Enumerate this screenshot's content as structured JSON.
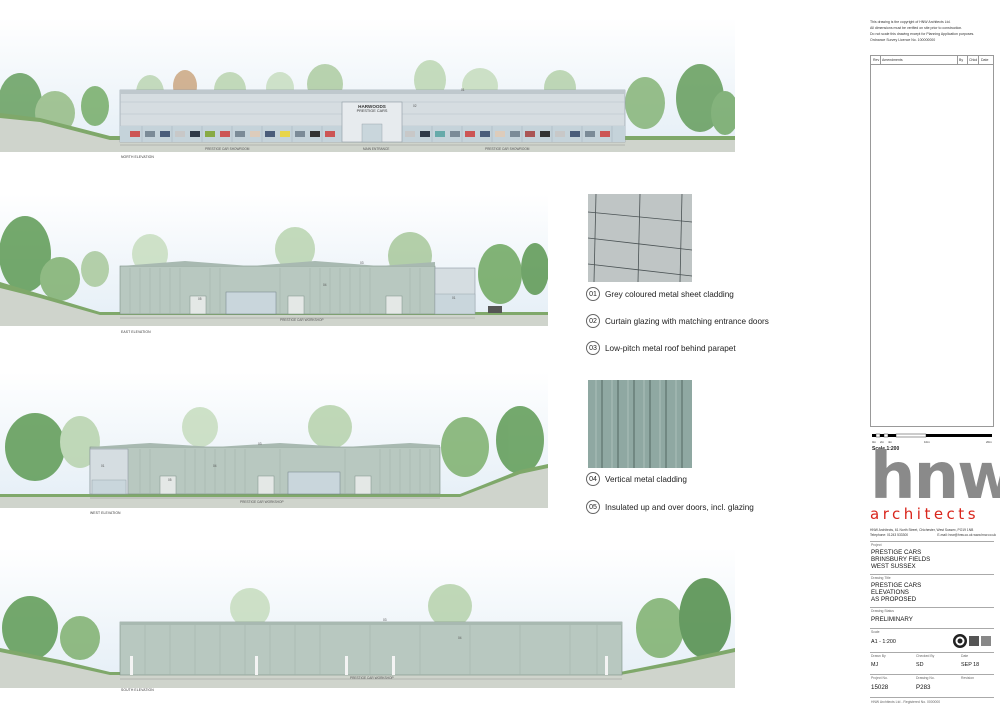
{
  "elevations": {
    "north": {
      "label": "NORTH ELEVATION",
      "sign_title": "HARWOODS",
      "sign_subtitle": "PRESTIGE CARS",
      "tag_01": "01",
      "tag_02": "02",
      "dim_left": "PRESTIGE CAR SHOWROOM",
      "dim_mid": "MAIN ENTRANCE",
      "dim_right": "PRESTIGE CAR SHOWROOM"
    },
    "east": {
      "label": "EAST ELEVATION",
      "dim": "PRESTIGE CAR WORKSHOP",
      "tag_03": "03",
      "tag_04": "04",
      "tag_05": "05",
      "tag_01": "01"
    },
    "west": {
      "label": "WEST ELEVATION",
      "dim": "PRESTIGE CAR WORKSHOP",
      "tag_03": "03",
      "tag_04": "04",
      "tag_05": "05",
      "tag_01": "01"
    },
    "south": {
      "label": "SOUTH ELEVATION",
      "dim": "PRESTIGE CAR WORKSHOP",
      "tag_03": "03",
      "tag_04": "04"
    }
  },
  "materials_key": [
    {
      "num": "01",
      "text": "Grey coloured metal sheet cladding"
    },
    {
      "num": "02",
      "text": "Curtain glazing with matching entrance doors"
    },
    {
      "num": "03",
      "text": "Low-pitch metal roof behind parapet"
    },
    {
      "num": "04",
      "text": "Vertical metal cladding"
    },
    {
      "num": "05",
      "text": "Insulated up and over doors, incl. glazing"
    }
  ],
  "notes": [
    "This drawing is the copyright of HNW Architects Ltd.",
    "All dimensions must be verified on site prior to construction.",
    "Do not scale this drawing except for Planning Application purposes.",
    "Ordnance Survey Licence No. 100000000"
  ],
  "revisions": {
    "headers": [
      "Rev",
      "Amendments",
      "By",
      "Chkd",
      "Date"
    ]
  },
  "scale_bar": {
    "ticks": [
      "0m",
      "2m",
      "4m",
      "10m",
      "20m"
    ],
    "label": "Scale 1:200"
  },
  "logo": {
    "word1": "hnw",
    "word2": "architects"
  },
  "colors": {
    "logo_grey": "#8a8a8a",
    "logo_red": "#d9261c",
    "cladding": "#b8c8c0",
    "glass": "#c9d6dc"
  },
  "practice": {
    "address": "HNW Architects, 61 North Street, Chichester, West Sussex, PO19 1NB",
    "telephone": "Telephone: 01243 533300",
    "email": "E-mail: hnw@hnw.co.uk  www.hnw.co.uk"
  },
  "title_block": {
    "project_caption": "Project",
    "project": [
      "PRESTIGE CARS",
      "BRINSBURY FIELDS",
      "WEST SUSSEX"
    ],
    "title_caption": "Drawing Title",
    "title": [
      "PRESTIGE CARS",
      "ELEVATIONS",
      "AS PROPOSED"
    ],
    "status_caption": "Drawing Status",
    "status": "PRELIMINARY",
    "scale_caption": "Scale",
    "scale": "A1 - 1:200",
    "drawn_caption": "Drawn By",
    "drawn": "MJ",
    "checked_caption": "Checked By",
    "checked": "SD",
    "date_caption": "Date",
    "date": "SEP 18",
    "project_no_caption": "Project No.",
    "project_no": "15028",
    "drawing_no_caption": "Drawing No.",
    "drawing_no": "P283",
    "revision_caption": "Revision",
    "revision": "",
    "footer": "HNW Architects Ltd - Registered No. 0000000"
  }
}
